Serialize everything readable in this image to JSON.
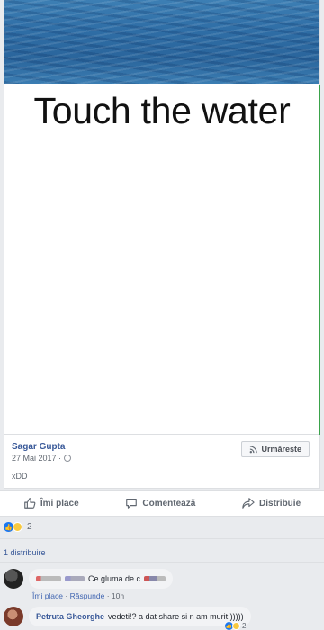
{
  "post": {
    "image_text": "Touch the water",
    "author": "Sagar Gupta",
    "date": "27 Mai 2017 ·",
    "caption": "xDD",
    "follow_label": "Urmărește"
  },
  "actions": {
    "like": "Îmi place",
    "comment": "Comentează",
    "share": "Distribuie"
  },
  "reactions": {
    "count": "2"
  },
  "shares": "1 distribuire",
  "comments": [
    {
      "author": "",
      "text": "Ce gluma de c",
      "like_label": "Îmi place",
      "reply_label": "Răspunde",
      "time": "10h"
    },
    {
      "author": "Petruta Gheorghe",
      "text": "vedeti!? a dat share si n am murit:)))))",
      "reaction_count": "2"
    }
  ],
  "colors": {
    "link": "#385898",
    "like_blue": "#1877f2",
    "sad_yellow": "#f7c940"
  },
  "icons": {
    "like": "thumbs-up-icon",
    "comment": "speech-bubble-icon",
    "share": "share-arrow-icon",
    "globe": "globe-icon"
  }
}
